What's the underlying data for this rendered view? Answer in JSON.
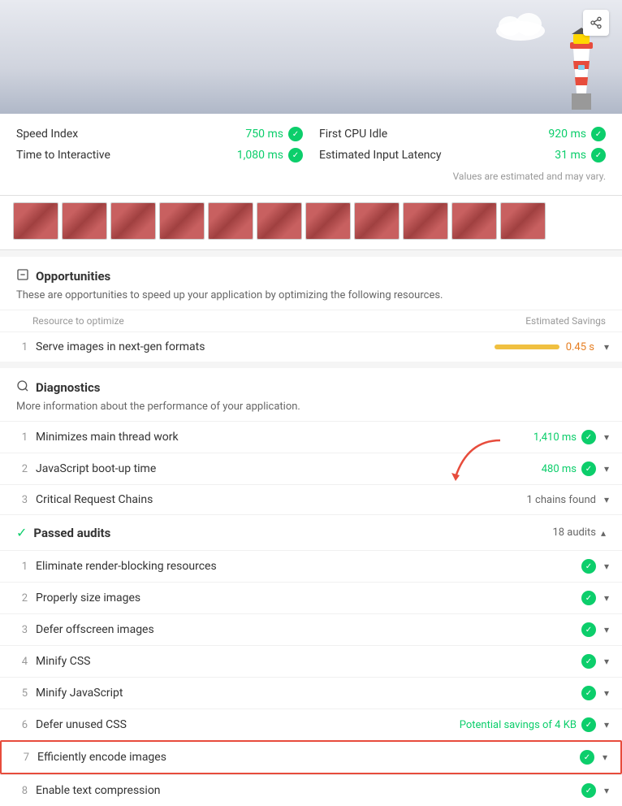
{
  "header": {
    "share_label": "share"
  },
  "metrics": {
    "speed_index_label": "Speed Index",
    "speed_index_value": "750 ms",
    "first_cpu_idle_label": "First CPU Idle",
    "first_cpu_idle_value": "920 ms",
    "time_to_interactive_label": "Time to Interactive",
    "time_to_interactive_value": "1,080 ms",
    "estimated_input_latency_label": "Estimated Input Latency",
    "estimated_input_latency_value": "31 ms",
    "values_note": "Values are estimated and may vary."
  },
  "opportunities": {
    "section_title": "Opportunities",
    "section_desc": "These are opportunities to speed up your application by optimizing the following resources.",
    "column_resource": "Resource to optimize",
    "column_savings": "Estimated Savings",
    "items": [
      {
        "num": "1",
        "label": "Serve images in next-gen formats",
        "savings": "0.45 s"
      }
    ]
  },
  "diagnostics": {
    "section_title": "Diagnostics",
    "section_desc": "More information about the performance of your application.",
    "items": [
      {
        "num": "1",
        "label": "Minimizes main thread work",
        "value": "1,410 ms",
        "type": "green"
      },
      {
        "num": "2",
        "label": "JavaScript boot-up time",
        "value": "480 ms",
        "type": "green"
      },
      {
        "num": "3",
        "label": "Critical Request Chains",
        "value": "1 chains found",
        "type": "neutral"
      }
    ]
  },
  "passed_audits": {
    "section_title": "Passed audits",
    "audits_count": "18 audits",
    "items": [
      {
        "num": "1",
        "label": "Eliminate render-blocking resources",
        "savings_text": "",
        "type": "check"
      },
      {
        "num": "2",
        "label": "Properly size images",
        "savings_text": "",
        "type": "check"
      },
      {
        "num": "3",
        "label": "Defer offscreen images",
        "savings_text": "",
        "type": "check"
      },
      {
        "num": "4",
        "label": "Minify CSS",
        "savings_text": "",
        "type": "check"
      },
      {
        "num": "5",
        "label": "Minify JavaScript",
        "savings_text": "",
        "type": "check"
      },
      {
        "num": "6",
        "label": "Defer unused CSS",
        "savings_text": "Potential savings of 4 KB",
        "type": "check"
      },
      {
        "num": "7",
        "label": "Efficiently encode images",
        "savings_text": "",
        "type": "check",
        "highlighted": true
      },
      {
        "num": "8",
        "label": "Enable text compression",
        "savings_text": "",
        "type": "check"
      }
    ]
  }
}
